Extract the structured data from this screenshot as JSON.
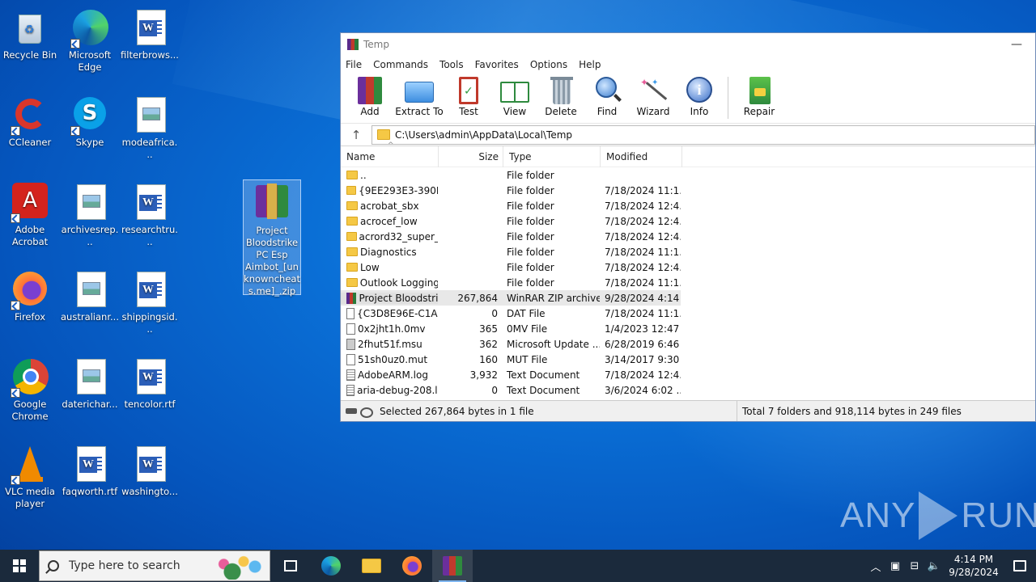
{
  "desktop": {
    "icons": [
      {
        "label": "Recycle Bin"
      },
      {
        "label": "Microsoft Edge"
      },
      {
        "label": "filterbrows..."
      },
      {
        "label": "CCleaner"
      },
      {
        "label": "Skype"
      },
      {
        "label": "modeafrica..."
      },
      {
        "label": "Adobe Acrobat"
      },
      {
        "label": "archivesrep..."
      },
      {
        "label": "researchtru..."
      },
      {
        "label": "Project Bloodstrike PC Esp Aimbot_[unknowncheats.me]_.zip"
      },
      {
        "label": "Firefox"
      },
      {
        "label": "australianr..."
      },
      {
        "label": "shippingsid..."
      },
      {
        "label": "Google Chrome"
      },
      {
        "label": "daterichar..."
      },
      {
        "label": "tencolor.rtf"
      },
      {
        "label": "VLC media player"
      },
      {
        "label": "faqworth.rtf"
      },
      {
        "label": "washingto..."
      }
    ]
  },
  "window": {
    "title": "Temp",
    "minimize": "—",
    "menu": [
      "File",
      "Commands",
      "Tools",
      "Favorites",
      "Options",
      "Help"
    ],
    "toolbar": [
      "Add",
      "Extract To",
      "Test",
      "View",
      "Delete",
      "Find",
      "Wizard",
      "Info",
      "Repair"
    ],
    "address": "C:\\Users\\admin\\AppData\\Local\\Temp",
    "up_arrow": "↑",
    "columns": [
      "Name",
      "Size",
      "Type",
      "Modified"
    ],
    "sort_indicator": "^",
    "files": [
      {
        "name": "..",
        "size": "",
        "type": "File folder",
        "modified": ""
      },
      {
        "name": "{9EE293E3-390D...",
        "size": "",
        "type": "File folder",
        "modified": "7/18/2024 11:1..."
      },
      {
        "name": "acrobat_sbx",
        "size": "",
        "type": "File folder",
        "modified": "7/18/2024 12:4..."
      },
      {
        "name": "acrocef_low",
        "size": "",
        "type": "File folder",
        "modified": "7/18/2024 12:4..."
      },
      {
        "name": "acrord32_super_...",
        "size": "",
        "type": "File folder",
        "modified": "7/18/2024 12:4..."
      },
      {
        "name": "Diagnostics",
        "size": "",
        "type": "File folder",
        "modified": "7/18/2024 11:1..."
      },
      {
        "name": "Low",
        "size": "",
        "type": "File folder",
        "modified": "7/18/2024 12:4..."
      },
      {
        "name": "Outlook Logging",
        "size": "",
        "type": "File folder",
        "modified": "7/18/2024 11:1..."
      },
      {
        "name": "Project Bloodstri...",
        "size": "267,864",
        "type": "WinRAR ZIP archive",
        "modified": "9/28/2024 4:14 ..."
      },
      {
        "name": "{C3D8E96E-C1A...",
        "size": "0",
        "type": "DAT File",
        "modified": "7/18/2024 11:1..."
      },
      {
        "name": "0x2jht1h.0mv",
        "size": "365",
        "type": "0MV File",
        "modified": "1/4/2023 12:47 ..."
      },
      {
        "name": "2fhut51f.msu",
        "size": "362",
        "type": "Microsoft Update ...",
        "modified": "6/28/2019 6:46 ..."
      },
      {
        "name": "51sh0uz0.mut",
        "size": "160",
        "type": "MUT File",
        "modified": "3/14/2017 9:30 ..."
      },
      {
        "name": "AdobeARM.log",
        "size": "3,932",
        "type": "Text Document",
        "modified": "7/18/2024 12:4..."
      },
      {
        "name": "aria-debug-208.l...",
        "size": "0",
        "type": "Text Document",
        "modified": "3/6/2024 6:02 ..."
      }
    ],
    "status_left": "Selected 267,864 bytes in 1 file",
    "status_right": "Total 7 folders and 918,114 bytes in 249 files"
  },
  "watermark": {
    "left": "ANY",
    "right": "RUN"
  },
  "taskbar": {
    "search_placeholder": "Type here to search",
    "time": "4:14 PM",
    "date": "9/28/2024",
    "tray_icons": [
      "chevron-up-icon",
      "meet-icon",
      "network-icon",
      "volume-icon"
    ]
  }
}
